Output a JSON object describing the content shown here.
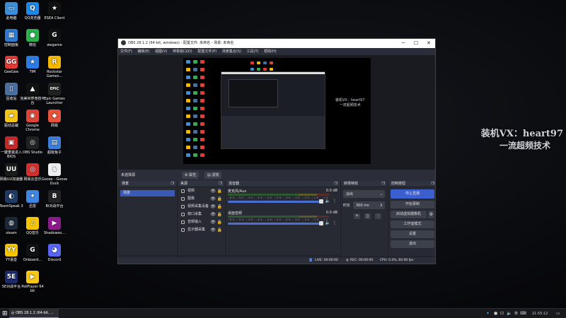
{
  "desktop_icons": [
    {
      "label": "此电脑",
      "color": "#3b8fd8",
      "glyph": "▭",
      "icon": "computer-icon"
    },
    {
      "label": "QQ浏览器",
      "color": "#1e88e5",
      "glyph": "Q",
      "icon": "qq-browser-icon"
    },
    {
      "label": "ESEA Client",
      "color": "#111",
      "glyph": "★",
      "icon": "esea-icon"
    },
    {
      "label": "控制面板",
      "color": "#2e7ad1",
      "glyph": "▦",
      "icon": "control-panel-icon"
    },
    {
      "label": "微信",
      "color": "#2bb24c",
      "glyph": "●",
      "icon": "wechat-icon"
    },
    {
      "label": "wegame",
      "color": "#111",
      "glyph": "G",
      "icon": "wegame-icon"
    },
    {
      "label": "GeeGee",
      "color": "#e53935",
      "glyph": "GG",
      "icon": "geegee-icon"
    },
    {
      "label": "TIM",
      "color": "#2d7be5",
      "glyph": "★",
      "icon": "tim-icon"
    },
    {
      "label": "Rockstar Games...",
      "color": "#f5b800",
      "glyph": "R",
      "icon": "rockstar-icon"
    },
    {
      "label": "回收站",
      "color": "#4a6f9e",
      "glyph": "▯",
      "icon": "recycle-bin-icon"
    },
    {
      "label": "完美世界竞技平台",
      "color": "#111",
      "glyph": "▲",
      "icon": "perfect-world-icon"
    },
    {
      "label": "Epic Games Launcher",
      "color": "#222",
      "glyph": "EPIC",
      "icon": "epic-games-icon"
    },
    {
      "label": "驱动总裁",
      "color": "#f0c419",
      "glyph": "▰",
      "icon": "driver-icon"
    },
    {
      "label": "Google Chrome",
      "color": "#db4437",
      "glyph": "◉",
      "icon": "chrome-icon"
    },
    {
      "label": "网易",
      "color": "#e8533c",
      "glyph": "◆",
      "icon": "netease-icon"
    },
    {
      "label": "一键重装进入BIOS",
      "color": "#c62828",
      "glyph": "▣",
      "icon": "bios-icon"
    },
    {
      "label": "OBS Studio",
      "color": "#222",
      "glyph": "◎",
      "icon": "obs-studio-icon"
    },
    {
      "label": "超级兔子",
      "color": "#3c7dd9",
      "glyph": "▤",
      "icon": "folder-icon"
    },
    {
      "label": "网易UU加速器",
      "color": "#1b1b1b",
      "glyph": "UU",
      "icon": "uu-accelerator-icon"
    },
    {
      "label": "网易云音乐",
      "color": "#d32f2f",
      "glyph": "◎",
      "icon": "netease-music-icon"
    },
    {
      "label": "Goose - Goose Duck",
      "color": "#eee",
      "glyph": "♞",
      "icon": "goose-duck-icon"
    },
    {
      "label": "TeamSpeak 3",
      "color": "#1f3b63",
      "glyph": "◐",
      "icon": "teamspeak-icon"
    },
    {
      "label": "迅雷",
      "color": "#3f86e0",
      "glyph": "✦",
      "icon": "xunlei-icon"
    },
    {
      "label": "BI对战平台",
      "color": "#222",
      "glyph": "B",
      "icon": "battle-platform-icon"
    },
    {
      "label": "steam",
      "color": "#1b2838",
      "glyph": "◍",
      "icon": "steam-icon"
    },
    {
      "label": "QQ音乐",
      "color": "#f8c600",
      "glyph": "♫",
      "icon": "qq-music-icon"
    },
    {
      "label": "Shadowso...",
      "color": "#8b1a8b",
      "glyph": "▶",
      "icon": "shadowsocks-icon"
    },
    {
      "label": "YY语音",
      "color": "#f8c600",
      "glyph": "YY",
      "icon": "yy-voice-icon"
    },
    {
      "label": "Onboard...",
      "color": "#111",
      "glyph": "G",
      "icon": "onboard-icon"
    },
    {
      "label": "Discord",
      "color": "#5865f2",
      "glyph": "◕",
      "icon": "discord-icon"
    },
    {
      "label": "5E对战平台",
      "color": "#1d2a6b",
      "glyph": "5E",
      "icon": "5e-platform-icon"
    },
    {
      "label": "PotPlayer 64 bit",
      "color": "#f5c518",
      "glyph": "▶",
      "icon": "potplayer-icon"
    }
  ],
  "watermark": {
    "line1": "装机VX：heart97",
    "line2": "一流超频技术"
  },
  "obs": {
    "title": "OBS 28.1.2 (64-bit, windows) - 配置文件: 未命名 - 场景: 未命名",
    "menu": [
      "文件(F)",
      "编辑(E)",
      "视图(V)",
      "停靠窗口(D)",
      "配置文件(P)",
      "场景集合(S)",
      "工具(T)",
      "帮助(H)"
    ],
    "preview_text": {
      "line1": "装机VX：heart97",
      "line2": "一流超频技术"
    },
    "scene_toolbar": {
      "label": "未选择源",
      "properties": "属性",
      "filters": "滤镜"
    },
    "docks": {
      "scenes": {
        "title": "场景",
        "items": [
          "场景"
        ]
      },
      "sources": {
        "title": "来源",
        "items": [
          {
            "label": "视频",
            "icon": "video-source-icon"
          },
          {
            "label": "图像",
            "icon": "image-source-icon"
          },
          {
            "label": "视频采集设备",
            "icon": "camera-source-icon"
          },
          {
            "label": "窗口采集",
            "icon": "window-capture-icon"
          },
          {
            "label": "音频输入",
            "icon": "mic-source-icon"
          },
          {
            "label": "显示器采集",
            "icon": "display-capture-icon"
          }
        ]
      },
      "mixer": {
        "title": "混音器",
        "channels": [
          {
            "name": "麦克风/Aux",
            "db": "0.0 dB"
          },
          {
            "name": "桌面音频",
            "db": "0.0 dB"
          }
        ],
        "ticks": "-60 -55 -50 -45 -40 -35 -30 -25 -20 -15 -10 -5 0"
      },
      "transitions": {
        "title": "转场特效",
        "type": "淡出",
        "duration_label": "时长",
        "duration": "300 ms"
      },
      "controls": {
        "title": "控制按钮",
        "buttons": [
          "停止直播",
          "开始录制",
          "启动虚拟摄像机",
          "工作室模式",
          "设置",
          "退出"
        ]
      }
    },
    "status": {
      "live": "LIVE: 00:00:00",
      "rec": "REC: 00:00:00",
      "cpu": "CPU: 0.4%, 60.00 fps"
    }
  },
  "taskbar": {
    "app": "OBS 28.1.2 (64-bit, ...",
    "lang": "英",
    "time": "21:55:12"
  },
  "colors": {
    "accent": "#3c5fcf",
    "panel": "#272a33",
    "desktop": "#07080b"
  }
}
